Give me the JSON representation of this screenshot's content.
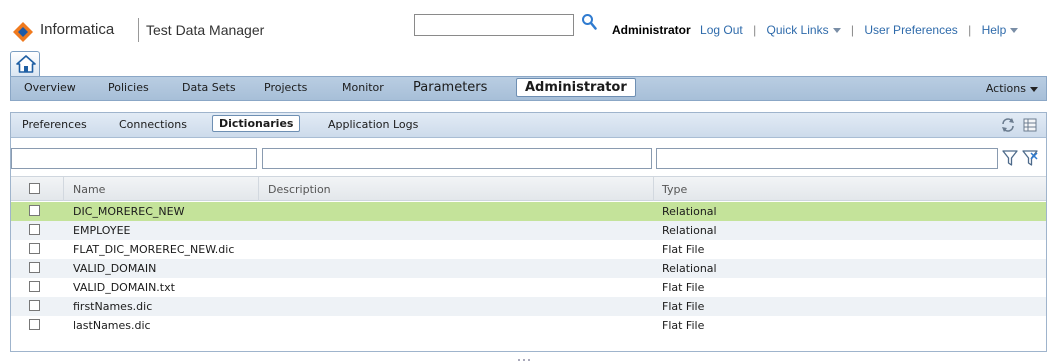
{
  "header": {
    "brand": "Informatica",
    "product": "Test Data Manager",
    "search_value": "",
    "user": "Administrator",
    "logout": "Log Out",
    "quick_links": "Quick Links",
    "user_prefs": "User Preferences",
    "help": "Help"
  },
  "nav": {
    "items": [
      "Overview",
      "Policies",
      "Data Sets",
      "Projects",
      "Monitor",
      "Parameters"
    ],
    "active": "Administrator",
    "actions": "Actions"
  },
  "subnav": {
    "items": [
      "Preferences",
      "Connections"
    ],
    "active": "Dictionaries",
    "after": "Application Logs"
  },
  "filters": {
    "name": "",
    "description": "",
    "type": ""
  },
  "table": {
    "columns": [
      "Name",
      "Description",
      "Type"
    ],
    "rows": [
      {
        "name": "DIC_MOREREC_NEW",
        "description": "",
        "type": "Relational"
      },
      {
        "name": "EMPLOYEE",
        "description": "",
        "type": "Relational"
      },
      {
        "name": "FLAT_DIC_MOREREC_NEW.dic",
        "description": "",
        "type": "Flat File"
      },
      {
        "name": "VALID_DOMAIN",
        "description": "",
        "type": "Relational"
      },
      {
        "name": "VALID_DOMAIN.txt",
        "description": "",
        "type": "Flat File"
      },
      {
        "name": "firstNames.dic",
        "description": "",
        "type": "Flat File"
      },
      {
        "name": "lastNames.dic",
        "description": "",
        "type": "Flat File"
      }
    ]
  },
  "colors": {
    "selected_row": "#c4e39a",
    "nav_bg": "#b9cde2",
    "brand_orange": "#f07a1e",
    "brand_blue": "#1d5aa8"
  }
}
